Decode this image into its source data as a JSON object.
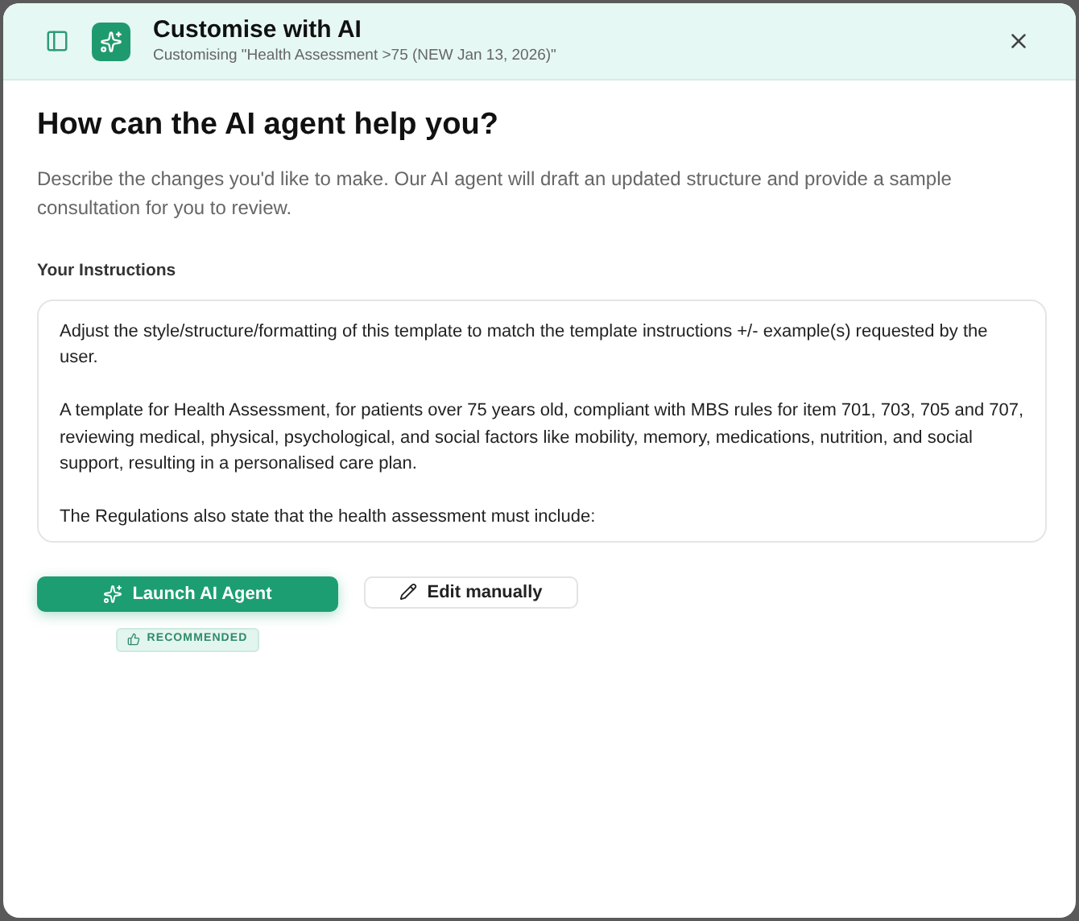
{
  "header": {
    "title": "Customise with AI",
    "subtitle": "Customising \"Health Assessment >75 (NEW Jan 13, 2026)\""
  },
  "heading": "How can the AI agent help you?",
  "description": "Describe the changes you'd like to make. Our AI agent will draft an updated structure and provide a sample consultation for you to review.",
  "instructions": {
    "label": "Your Instructions",
    "paragraphs": [
      "Adjust the style/structure/formatting of this template to match the template instructions +/- example(s) requested by the user.",
      "A template for Health Assessment, for patients over 75 years old, compliant with MBS rules for item 701, 703, 705 and 707, reviewing medical, physical, psychological, and social factors like mobility, memory, medications, nutrition, and social support, resulting in a personalised care plan.",
      "The Regulations also state that the health assessment must include:"
    ]
  },
  "actions": {
    "primary": "Launch AI Agent",
    "badge": "RECOMMENDED",
    "secondary": "Edit manually"
  }
}
